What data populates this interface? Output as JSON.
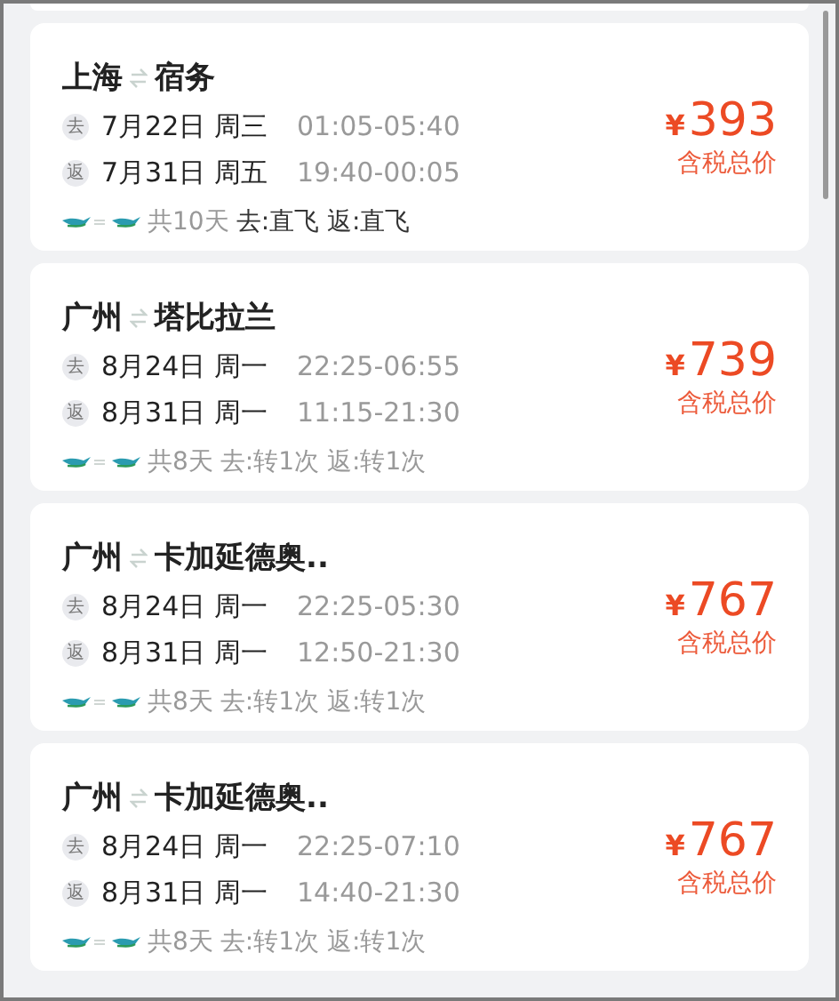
{
  "flights": [
    {
      "origin": "上海",
      "destination": "宿务",
      "outbound": {
        "badge": "去",
        "date": "7月22日 周三",
        "time": "01:05-05:40"
      },
      "inbound": {
        "badge": "返",
        "date": "7月31日 周五",
        "time": "19:40-00:05"
      },
      "duration": "共10天",
      "stops": "去:直飞 返:直飞",
      "direct": true,
      "price_symbol": "¥",
      "price": "393",
      "price_note": "含税总价"
    },
    {
      "origin": "广州",
      "destination": "塔比拉兰",
      "outbound": {
        "badge": "去",
        "date": "8月24日 周一",
        "time": "22:25-06:55"
      },
      "inbound": {
        "badge": "返",
        "date": "8月31日 周一",
        "time": "11:15-21:30"
      },
      "duration": "共8天",
      "stops": "去:转1次 返:转1次",
      "direct": false,
      "price_symbol": "¥",
      "price": "739",
      "price_note": "含税总价"
    },
    {
      "origin": "广州",
      "destination": "卡加延德奥..",
      "outbound": {
        "badge": "去",
        "date": "8月24日 周一",
        "time": "22:25-05:30"
      },
      "inbound": {
        "badge": "返",
        "date": "8月31日 周一",
        "time": "12:50-21:30"
      },
      "duration": "共8天",
      "stops": "去:转1次 返:转1次",
      "direct": false,
      "price_symbol": "¥",
      "price": "767",
      "price_note": "含税总价"
    },
    {
      "origin": "广州",
      "destination": "卡加延德奥..",
      "outbound": {
        "badge": "去",
        "date": "8月24日 周一",
        "time": "22:25-07:10"
      },
      "inbound": {
        "badge": "返",
        "date": "8月31日 周一",
        "time": "14:40-21:30"
      },
      "duration": "共8天",
      "stops": "去:转1次 返:转1次",
      "direct": false,
      "price_symbol": "¥",
      "price": "767",
      "price_note": "含税总价"
    }
  ]
}
